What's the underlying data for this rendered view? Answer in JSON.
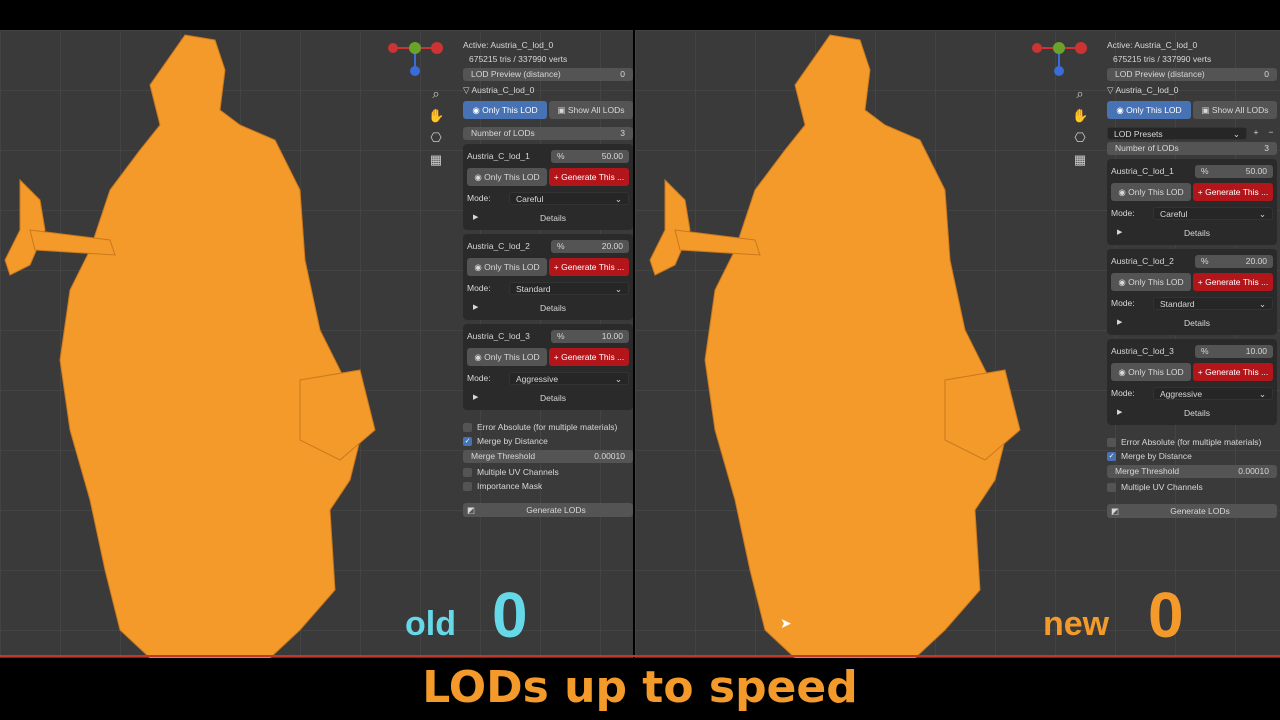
{
  "left": {
    "panel": {
      "active": "Active: Austria_C_lod_0",
      "stats": "675215 tris / 337990 verts",
      "preview_label": "LOD Preview (distance)",
      "preview_value": "0",
      "object_name": "Austria_C_lod_0",
      "only_this_lod": "Only This LOD",
      "show_all_lods": "Show All LODs",
      "num_lods_label": "Number of LODs",
      "num_lods_value": "3",
      "lods": [
        {
          "name": "Austria_C_lod_1",
          "pct_symbol": "%",
          "pct": "50.00",
          "only": "Only This LOD",
          "gen": "Generate This ...",
          "mode_label": "Mode:",
          "mode": "Careful",
          "details": "Details"
        },
        {
          "name": "Austria_C_lod_2",
          "pct_symbol": "%",
          "pct": "20.00",
          "only": "Only This LOD",
          "gen": "Generate This ...",
          "mode_label": "Mode:",
          "mode": "Standard",
          "details": "Details"
        },
        {
          "name": "Austria_C_lod_3",
          "pct_symbol": "%",
          "pct": "10.00",
          "only": "Only This LOD",
          "gen": "Generate This ...",
          "mode_label": "Mode:",
          "mode": "Aggressive",
          "details": "Details"
        }
      ],
      "error_absolute": "Error Absolute (for multiple materials)",
      "merge_by_distance": "Merge by Distance",
      "merge_threshold_label": "Merge Threshold",
      "merge_threshold_value": "0.00010",
      "multiple_uv": "Multiple UV Channels",
      "importance_mask": "Importance Mask",
      "generate_lods": "Generate LODs"
    },
    "label_word": "old",
    "label_num": "0"
  },
  "right": {
    "panel": {
      "active": "Active: Austria_C_lod_0",
      "stats": "675215 tris / 337990 verts",
      "preview_label": "LOD Preview (distance)",
      "preview_value": "0",
      "object_name": "Austria_C_lod_0",
      "only_this_lod": "Only This LOD",
      "show_all_lods": "Show All LODs",
      "presets_label": "LOD Presets",
      "num_lods_label": "Number of LODs",
      "num_lods_value": "3",
      "lods": [
        {
          "name": "Austria_C_lod_1",
          "pct_symbol": "%",
          "pct": "50.00",
          "only": "Only This LOD",
          "gen": "Generate This ...",
          "mode_label": "Mode:",
          "mode": "Careful",
          "details": "Details"
        },
        {
          "name": "Austria_C_lod_2",
          "pct_symbol": "%",
          "pct": "20.00",
          "only": "Only This LOD",
          "gen": "Generate This ...",
          "mode_label": "Mode:",
          "mode": "Standard",
          "details": "Details"
        },
        {
          "name": "Austria_C_lod_3",
          "pct_symbol": "%",
          "pct": "10.00",
          "only": "Only This LOD",
          "gen": "Generate This ...",
          "mode_label": "Mode:",
          "mode": "Aggressive",
          "details": "Details"
        }
      ],
      "error_absolute": "Error Absolute (for multiple materials)",
      "merge_by_distance": "Merge by Distance",
      "merge_threshold_label": "Merge Threshold",
      "merge_threshold_value": "0.00010",
      "multiple_uv": "Multiple UV Channels",
      "generate_lods": "Generate LODs"
    },
    "label_word": "new",
    "label_num": "0"
  },
  "gizmo": {
    "y": "Y",
    "x": "X"
  },
  "caption": "LODs up to speed",
  "colors": {
    "mesh": "#f39a2b",
    "old_label": "#66d9e8",
    "new_label": "#f39a2b",
    "active_toggle": "#4772b3",
    "generate_button": "#b3161a"
  }
}
